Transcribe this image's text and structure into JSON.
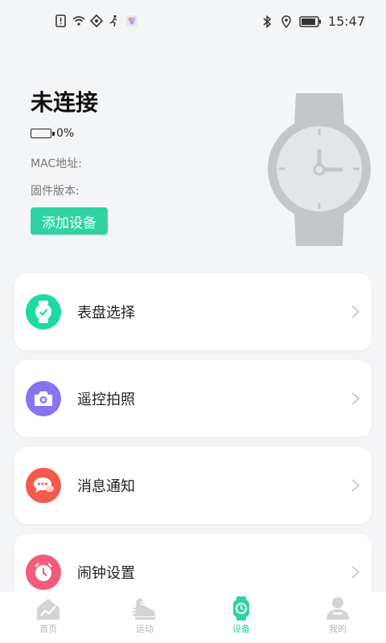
{
  "status_bar": {
    "time": "15:47",
    "icons_left": [
      "sim-alert-icon",
      "wifi-icon",
      "hotspot-icon",
      "runner-app-icon",
      "photos-app-icon"
    ],
    "icons_right": [
      "bluetooth-icon",
      "location-icon",
      "battery-icon"
    ]
  },
  "device": {
    "status_title": "未连接",
    "battery_percent": "0%",
    "mac_label": "MAC地址:",
    "firmware_label": "固件版本:",
    "add_device_label": "添加设备",
    "image": "watch-illustration"
  },
  "menu": [
    {
      "label": "表盘选择",
      "icon": "watch-face-icon",
      "color": "#1ed9a4"
    },
    {
      "label": "遥控拍照",
      "icon": "camera-icon",
      "color": "#8a73f0"
    },
    {
      "label": "消息通知",
      "icon": "message-icon",
      "color": "#f35a4c"
    },
    {
      "label": "闹钟设置",
      "icon": "alarm-icon",
      "color": "#f25b7e"
    }
  ],
  "tabbar": {
    "tabs": [
      {
        "label": "首页",
        "icon": "home-chart-icon",
        "active": false
      },
      {
        "label": "运动",
        "icon": "sneaker-icon",
        "active": false
      },
      {
        "label": "设备",
        "icon": "smartwatch-icon",
        "active": true
      },
      {
        "label": "我的",
        "icon": "profile-icon",
        "active": false
      }
    ],
    "active_color": "#2fd3a2",
    "inactive_color": "#b5b5b5"
  }
}
